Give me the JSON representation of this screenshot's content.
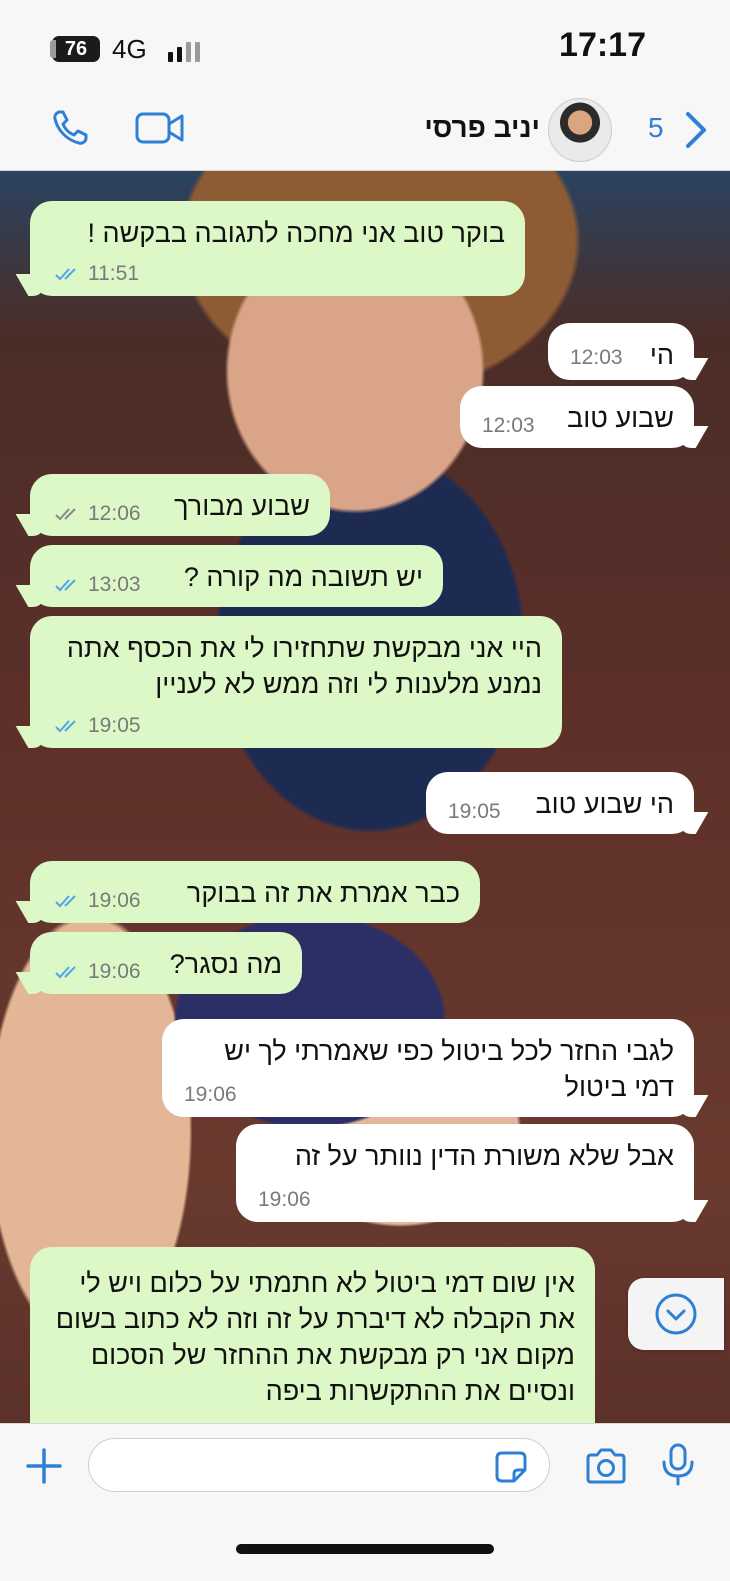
{
  "status_bar": {
    "battery": "76",
    "network": "4G",
    "time": "17:17"
  },
  "header": {
    "contact_name": "יניב פרסי",
    "back_count": "5",
    "icons": [
      "phone-icon",
      "video-icon",
      "back-chevron-icon"
    ]
  },
  "colors": {
    "accent": "#2f7fd6",
    "outgoing_bubble": "#dcf8c6",
    "incoming_bubble": "#ffffff",
    "read_ticks": "#4fa6e8"
  },
  "messages": [
    {
      "dir": "out",
      "text": "בוקר טוב אני מחכה לתגובה בבקשה !",
      "time": "11:51",
      "ticks": "read"
    },
    {
      "dir": "in",
      "text": "הי",
      "time": "12:03"
    },
    {
      "dir": "in",
      "text": "שבוע טוב",
      "time": "12:03"
    },
    {
      "dir": "out",
      "text": "שבוע מבורך",
      "time": "12:06",
      "ticks": "delivered"
    },
    {
      "dir": "out",
      "text": "יש תשובה מה קורה ?",
      "time": "13:03",
      "ticks": "read"
    },
    {
      "dir": "out",
      "text": "היי אני מבקשת שתחזירו לי את הכסף אתה נמנע מלענות לי וזה ממש לא לעניין",
      "time": "19:05",
      "ticks": "read"
    },
    {
      "dir": "in",
      "text": "הי שבוע טוב",
      "time": "19:05"
    },
    {
      "dir": "out",
      "text": "כבר אמרת את זה בבוקר",
      "time": "19:06",
      "ticks": "read"
    },
    {
      "dir": "out",
      "text": "מה נסגר?",
      "time": "19:06",
      "ticks": "read"
    },
    {
      "dir": "in",
      "text": "לגבי החזר לכל ביטול כפי שאמרתי לך יש דמי ביטול",
      "time": "19:06"
    },
    {
      "dir": "in",
      "text": "אבל שלא משורת הדין נוותר על זה",
      "time": "19:06"
    },
    {
      "dir": "out",
      "text": "אין שום דמי ביטול לא חתמתי על כלום ויש לי את הקבלה לא דיברת על זה וזה לא כתוב בשום מקום אני רק מבקשת את ההחזר של הסכום ונסיים את ההתקשרות ביפה",
      "time": "",
      "ticks": ""
    }
  ],
  "composer": {
    "placeholder": "",
    "icons": [
      "plus-icon",
      "sticker-icon",
      "camera-icon",
      "microphone-icon"
    ]
  },
  "scroll_button": {
    "icon": "chevron-down-circle-icon"
  }
}
